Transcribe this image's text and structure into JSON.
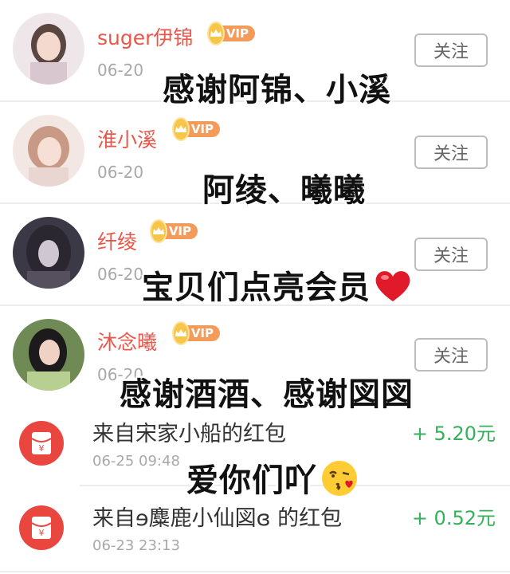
{
  "members": [
    {
      "name": "suger伊锦",
      "vip": "VIP",
      "date": "06-20",
      "follow": "关注"
    },
    {
      "name": "淮小溪",
      "vip": "VIP",
      "date": "06-20",
      "follow": "关注"
    },
    {
      "name": "纤绫",
      "vip": "VIP",
      "date": "06-20",
      "follow": "关注"
    },
    {
      "name": "沐念曦",
      "vip": "VIP",
      "date": "06-20",
      "follow": "关注"
    }
  ],
  "red_envelopes": [
    {
      "title": "来自宋家小船的红包",
      "time": "06-25 09:48",
      "amount": "+ 5.20元"
    },
    {
      "title": "来自ɘ麋鹿小仙図ɞ 的红包",
      "time": "06-23 23:13",
      "amount": "+ 0.52元"
    }
  ],
  "captions": {
    "line1": "感谢阿锦、小溪",
    "line2": "阿绫、曦曦",
    "line3": "宝贝们点亮会员",
    "line4": "感谢酒酒、感谢図図",
    "line5": "爱你们吖"
  },
  "colors": {
    "name": "#e8574a",
    "vip_badge": "#f49b5a",
    "crown": "#f6c64a",
    "amount": "#35b05a",
    "red_icon": "#e9463f"
  },
  "icons": {
    "envelope": "red-envelope-icon",
    "heart": "red-heart-emoji",
    "kiss": "kissing-face-emoji"
  }
}
